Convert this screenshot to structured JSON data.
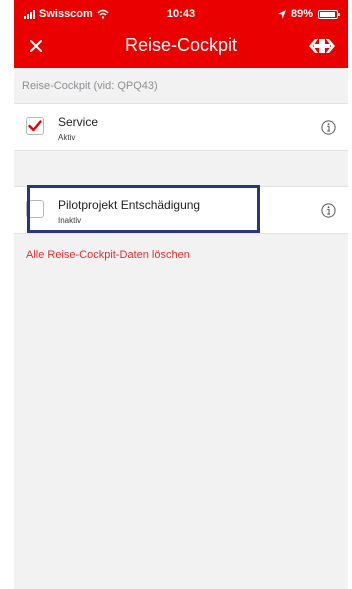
{
  "status_bar": {
    "carrier": "Swisscom",
    "time": "10:43",
    "battery": "89%"
  },
  "header": {
    "title": "Reise-Cockpit",
    "close_icon": "close-icon",
    "logo_icon": "sbb-logo-icon"
  },
  "section": {
    "label": "Reise-Cockpit (vid: QPQ43)"
  },
  "items": [
    {
      "title": "Service",
      "status": "Aktiv",
      "checked": true
    },
    {
      "title": "Pilotprojekt Entschädigung",
      "status": "Inaktiv",
      "checked": false
    }
  ],
  "actions": {
    "delete_all": "Alle Reise-Cockpit-Daten löschen"
  },
  "colors": {
    "brand_red": "#eb0000",
    "highlight_border": "#2b3675",
    "link_red": "#e03030"
  }
}
